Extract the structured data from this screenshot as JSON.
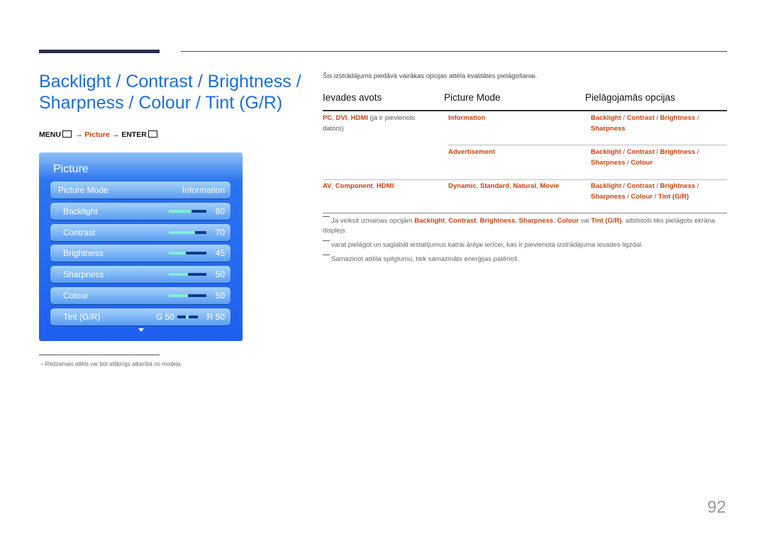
{
  "title_line1": "Backlight / Contrast / Brightness /",
  "title_line2": "Sharpness / Colour / Tint (G/R)",
  "menu_path": {
    "menu": "MENU",
    "arrow1": "→",
    "picture": "Picture",
    "arrow2": "→",
    "enter": "ENTER"
  },
  "panel": {
    "title": "Picture",
    "picture_mode_label": "Picture Mode",
    "picture_mode_value": "Information",
    "items": [
      {
        "label": "Backlight",
        "value": 60
      },
      {
        "label": "Contrast",
        "value": 70
      },
      {
        "label": "Brightness",
        "value": 45
      },
      {
        "label": "Sharpness",
        "value": 50
      },
      {
        "label": "Colour",
        "value": 50
      }
    ],
    "tint": {
      "label": "Tint (G/R)",
      "g": "G 50",
      "r": "R 50"
    },
    "colors": {
      "bg": "#1f5ff0",
      "fill": "#7ff0d0"
    }
  },
  "footnote": "Redzamais attēls var būt atšķirīgs atkarībā no modeļa.",
  "intro": "Šis izstrādājums piedāvā vairākas opcijas attēla kvalitātes pielāgošanai.",
  "table": {
    "headers": [
      "Ievades avots",
      "Picture Mode",
      "Pielāgojamās opcijas"
    ],
    "r1": {
      "src_a": "PC",
      "src_b": "DVI",
      "src_c": "HDMI",
      "src_note": " (ja ir pievienots dators)",
      "mode": "Information",
      "opts1": "Backlight",
      "opts2": "Contrast",
      "opts3": "Brightness",
      "opts4": "Sharpness"
    },
    "r2": {
      "mode": "Advertisement",
      "opts1": "Backlight",
      "opts2": "Contrast",
      "opts3": "Brightness",
      "opts4": "Sharpness",
      "opts5": "Colour"
    },
    "r3": {
      "src_a": "AV",
      "src_b": "Component",
      "src_c": "HDMI",
      "m1": "Dynamic",
      "m2": "Standard",
      "m3": "Natural",
      "m4": "Movie",
      "opts1": "Backlight",
      "opts2": "Contrast",
      "opts3": "Brightness",
      "opts4": "Sharpness",
      "opts5": "Colour",
      "opts6": "Tint (G/R)"
    }
  },
  "notes": {
    "n1_a": "Ja veiksit izmaiņas opcijām ",
    "k1": "Backlight",
    "k2": "Contrast",
    "k3": "Brightness",
    "k4": "Sharpness",
    "k5": "Colour",
    "n1_vai": " vai ",
    "k6": "Tint (G/R)",
    "n1_b": ", atbilstoši tiks pielāgots ekrāna displejs.",
    "n2": "varat pielāgot un saglabāt iestatījumus katrai ārējai ierīcei, kas ir pievienota izstrādājuma ievades ligzdai.",
    "n3": "Samazinot attēla spilgtumu, tiek samazināts enerģijas patēriņš."
  },
  "page_number": "92",
  "accent": "#c8400e",
  "title_color": "#1a6ed8"
}
